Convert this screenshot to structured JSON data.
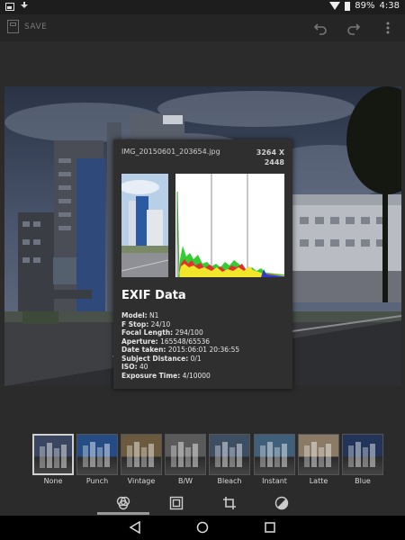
{
  "status_bar": {
    "left_icons": [
      "gallery-notification-icon",
      "download-icon"
    ],
    "battery": "89%",
    "time": "4:38"
  },
  "toolbar": {
    "save_label": "SAVE",
    "icons": [
      "undo-icon",
      "redo-icon",
      "overflow-menu-icon"
    ]
  },
  "exif": {
    "filename": "IMG_20150601_203654.jpg",
    "size_line1": "3264 X",
    "size_line2": "2448",
    "title": "EXIF Data",
    "fields": [
      {
        "label": "Model:",
        "value": "N1"
      },
      {
        "label": "F Stop:",
        "value": "24/10"
      },
      {
        "label": "Focal Length:",
        "value": "294/100"
      },
      {
        "label": "Aperture:",
        "value": "165548/65536"
      },
      {
        "label": "Date taken:",
        "value": "2015:06:01 20:36:55"
      },
      {
        "label": "Subject Distance:",
        "value": "0/1"
      },
      {
        "label": "ISO:",
        "value": "40"
      },
      {
        "label": "Exposure Time:",
        "value": "4/10000"
      }
    ]
  },
  "filters": [
    {
      "label": "None",
      "selected": true,
      "tint": "#3a4660"
    },
    {
      "label": "Punch",
      "selected": false,
      "tint": "#264c86"
    },
    {
      "label": "Vintage",
      "selected": false,
      "tint": "#6b5a3e"
    },
    {
      "label": "B/W",
      "selected": false,
      "tint": "#5a5a5a"
    },
    {
      "label": "Bleach",
      "selected": false,
      "tint": "#3d4e63"
    },
    {
      "label": "Instant",
      "selected": false,
      "tint": "#3f5f7a"
    },
    {
      "label": "Latte",
      "selected": false,
      "tint": "#8a7a66"
    },
    {
      "label": "Blue",
      "selected": false,
      "tint": "#22345a"
    }
  ],
  "bottom_tools": [
    "filters-icon",
    "frame-icon",
    "crop-icon",
    "adjust-icon"
  ],
  "nav_icons": [
    "back-icon",
    "home-icon",
    "recents-icon"
  ]
}
